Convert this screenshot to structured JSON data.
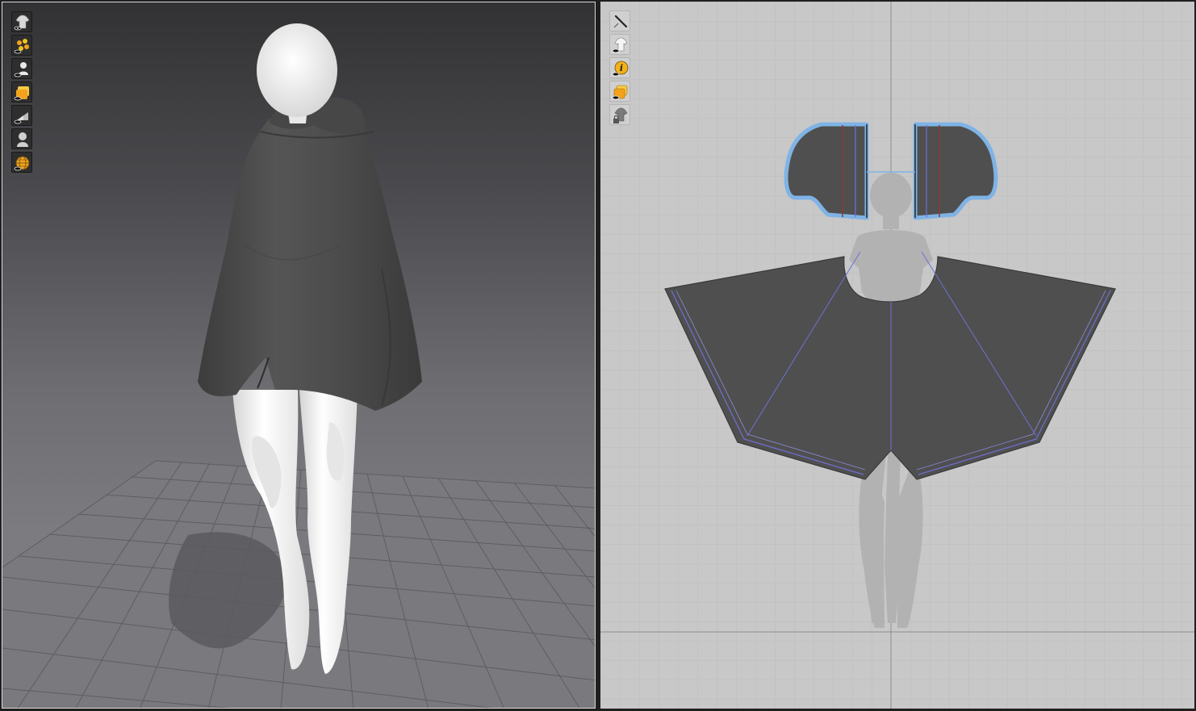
{
  "window": {
    "panels": [
      {
        "id": "3d-garment-window"
      },
      {
        "id": "2d-pattern-window"
      }
    ]
  },
  "toolbar_3d": {
    "buttons": [
      {
        "icon": "garment-display-icon"
      },
      {
        "icon": "fabric-points-icon"
      },
      {
        "icon": "avatar-display-icon"
      },
      {
        "icon": "texture-display-icon"
      },
      {
        "icon": "shading-icon"
      },
      {
        "icon": "avatar-silhouette-icon"
      },
      {
        "icon": "mesh-globe-icon"
      }
    ]
  },
  "toolbar_2d": {
    "buttons": [
      {
        "icon": "needle-icon"
      },
      {
        "icon": "garment-visibility-icon"
      },
      {
        "icon": "info-icon"
      },
      {
        "icon": "pattern-texture-icon"
      },
      {
        "icon": "garment-lock-icon"
      }
    ]
  },
  "colors": {
    "fabric": "#4f4f4f",
    "fabric_shade": "#3d3d3d",
    "avatar": "#f2f2f2",
    "selection_outline": "#7fb3e6",
    "internal_line": "#6f6fd8",
    "seam_line": "#8a3a3a",
    "grid_2d": "#bcbcbc",
    "icon_orange": "#f2a31b"
  }
}
